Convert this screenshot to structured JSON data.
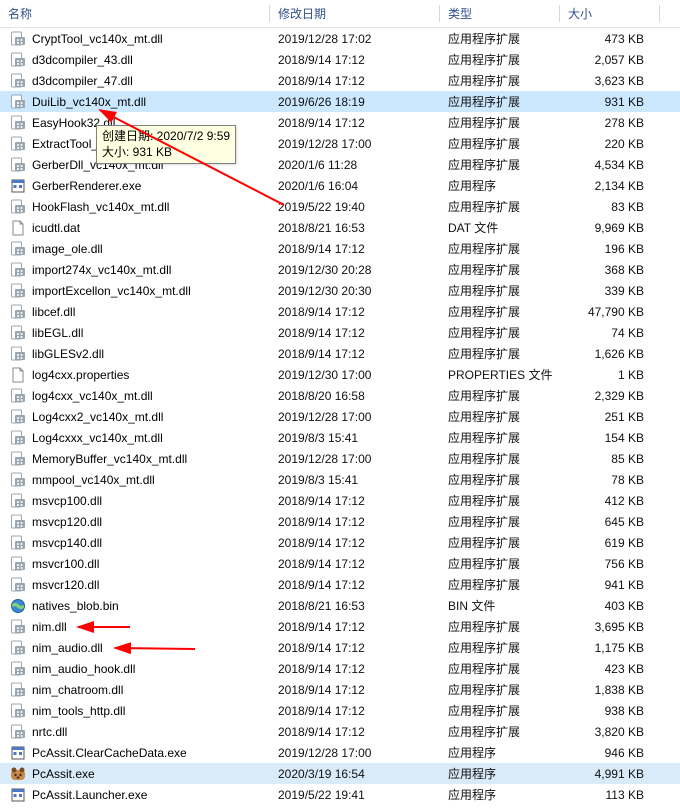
{
  "columns": {
    "name": "名称",
    "date": "修改日期",
    "type": "类型",
    "size": "大小"
  },
  "tooltip": {
    "line1": "创建日期: 2020/7/2 9:59",
    "line2": "大小: 931 KB"
  },
  "file_types": {
    "app_ext": "应用程序扩展",
    "app": "应用程序",
    "dat": "DAT 文件",
    "bin": "BIN 文件",
    "props": "PROPERTIES 文件"
  },
  "files": [
    {
      "name": "CryptTool_vc140x_mt.dll",
      "date": "2019/12/28 17:02",
      "type": "app_ext",
      "size": "473 KB",
      "icon": "dll"
    },
    {
      "name": "d3dcompiler_43.dll",
      "date": "2018/9/14 17:12",
      "type": "app_ext",
      "size": "2,057 KB",
      "icon": "dll"
    },
    {
      "name": "d3dcompiler_47.dll",
      "date": "2018/9/14 17:12",
      "type": "app_ext",
      "size": "3,623 KB",
      "icon": "dll"
    },
    {
      "name": "DuiLib_vc140x_mt.dll",
      "date": "2019/6/26 18:19",
      "type": "app_ext",
      "size": "931 KB",
      "icon": "dll",
      "selected": true
    },
    {
      "name": "EasyHook32.dll",
      "date": "2018/9/14 17:12",
      "type": "app_ext",
      "size": "278 KB",
      "icon": "dll"
    },
    {
      "name": "ExtractTool_vc140x_mt.dll",
      "date": "2019/12/28 17:00",
      "type": "app_ext",
      "size": "220 KB",
      "icon": "dll"
    },
    {
      "name": "GerberDll_vc140x_mt.dll",
      "date": "2020/1/6 11:28",
      "type": "app_ext",
      "size": "4,534 KB",
      "icon": "dll"
    },
    {
      "name": "GerberRenderer.exe",
      "date": "2020/1/6 16:04",
      "type": "app",
      "size": "2,134 KB",
      "icon": "exe"
    },
    {
      "name": "HookFlash_vc140x_mt.dll",
      "date": "2019/5/22 19:40",
      "type": "app_ext",
      "size": "83 KB",
      "icon": "dll"
    },
    {
      "name": "icudtl.dat",
      "date": "2018/8/21 16:53",
      "type": "dat",
      "size": "9,969 KB",
      "icon": "file"
    },
    {
      "name": "image_ole.dll",
      "date": "2018/9/14 17:12",
      "type": "app_ext",
      "size": "196 KB",
      "icon": "dll"
    },
    {
      "name": "import274x_vc140x_mt.dll",
      "date": "2019/12/30 20:28",
      "type": "app_ext",
      "size": "368 KB",
      "icon": "dll"
    },
    {
      "name": "importExcellon_vc140x_mt.dll",
      "date": "2019/12/30 20:30",
      "type": "app_ext",
      "size": "339 KB",
      "icon": "dll"
    },
    {
      "name": "libcef.dll",
      "date": "2018/9/14 17:12",
      "type": "app_ext",
      "size": "47,790 KB",
      "icon": "dll"
    },
    {
      "name": "libEGL.dll",
      "date": "2018/9/14 17:12",
      "type": "app_ext",
      "size": "74 KB",
      "icon": "dll"
    },
    {
      "name": "libGLESv2.dll",
      "date": "2018/9/14 17:12",
      "type": "app_ext",
      "size": "1,626 KB",
      "icon": "dll"
    },
    {
      "name": "log4cxx.properties",
      "date": "2019/12/30 17:00",
      "type": "props",
      "size": "1 KB",
      "icon": "file"
    },
    {
      "name": "log4cxx_vc140x_mt.dll",
      "date": "2018/8/20 16:58",
      "type": "app_ext",
      "size": "2,329 KB",
      "icon": "dll"
    },
    {
      "name": "Log4cxx2_vc140x_mt.dll",
      "date": "2019/12/28 17:00",
      "type": "app_ext",
      "size": "251 KB",
      "icon": "dll"
    },
    {
      "name": "Log4cxxx_vc140x_mt.dll",
      "date": "2019/8/3 15:41",
      "type": "app_ext",
      "size": "154 KB",
      "icon": "dll"
    },
    {
      "name": "MemoryBuffer_vc140x_mt.dll",
      "date": "2019/12/28 17:00",
      "type": "app_ext",
      "size": "85 KB",
      "icon": "dll"
    },
    {
      "name": "mmpool_vc140x_mt.dll",
      "date": "2019/8/3 15:41",
      "type": "app_ext",
      "size": "78 KB",
      "icon": "dll"
    },
    {
      "name": "msvcp100.dll",
      "date": "2018/9/14 17:12",
      "type": "app_ext",
      "size": "412 KB",
      "icon": "dll"
    },
    {
      "name": "msvcp120.dll",
      "date": "2018/9/14 17:12",
      "type": "app_ext",
      "size": "645 KB",
      "icon": "dll"
    },
    {
      "name": "msvcp140.dll",
      "date": "2018/9/14 17:12",
      "type": "app_ext",
      "size": "619 KB",
      "icon": "dll"
    },
    {
      "name": "msvcr100.dll",
      "date": "2018/9/14 17:12",
      "type": "app_ext",
      "size": "756 KB",
      "icon": "dll"
    },
    {
      "name": "msvcr120.dll",
      "date": "2018/9/14 17:12",
      "type": "app_ext",
      "size": "941 KB",
      "icon": "dll"
    },
    {
      "name": "natives_blob.bin",
      "date": "2018/8/21 16:53",
      "type": "bin",
      "size": "403 KB",
      "icon": "globe"
    },
    {
      "name": "nim.dll",
      "date": "2018/9/14 17:12",
      "type": "app_ext",
      "size": "3,695 KB",
      "icon": "dll"
    },
    {
      "name": "nim_audio.dll",
      "date": "2018/9/14 17:12",
      "type": "app_ext",
      "size": "1,175 KB",
      "icon": "dll"
    },
    {
      "name": "nim_audio_hook.dll",
      "date": "2018/9/14 17:12",
      "type": "app_ext",
      "size": "423 KB",
      "icon": "dll"
    },
    {
      "name": "nim_chatroom.dll",
      "date": "2018/9/14 17:12",
      "type": "app_ext",
      "size": "1,838 KB",
      "icon": "dll"
    },
    {
      "name": "nim_tools_http.dll",
      "date": "2018/9/14 17:12",
      "type": "app_ext",
      "size": "938 KB",
      "icon": "dll"
    },
    {
      "name": "nrtc.dll",
      "date": "2018/9/14 17:12",
      "type": "app_ext",
      "size": "3,820 KB",
      "icon": "dll"
    },
    {
      "name": "PcAssit.ClearCacheData.exe",
      "date": "2019/12/28 17:00",
      "type": "app",
      "size": "946 KB",
      "icon": "exe"
    },
    {
      "name": "PcAssit.exe",
      "date": "2020/3/19 16:54",
      "type": "app",
      "size": "4,991 KB",
      "icon": "pcassit",
      "highlighted": true
    },
    {
      "name": "PcAssit.Launcher.exe",
      "date": "2019/5/22 19:41",
      "type": "app",
      "size": "113 KB",
      "icon": "exe"
    }
  ]
}
